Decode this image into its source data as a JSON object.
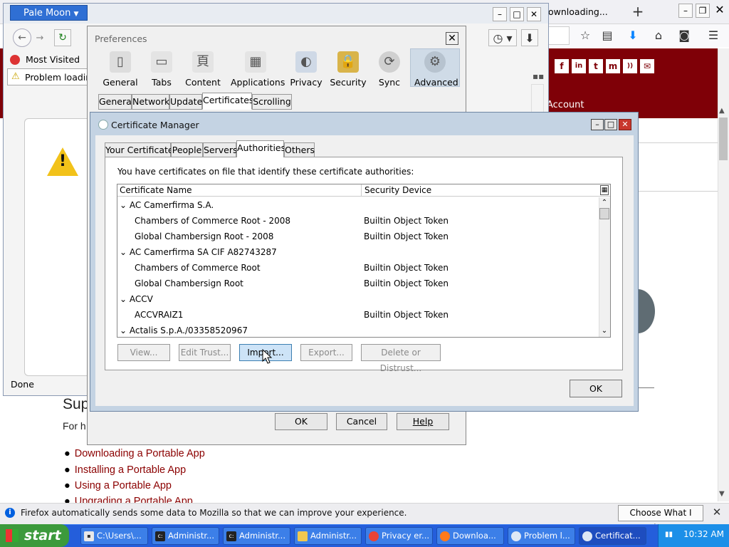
{
  "firefox": {
    "tab_title": "ownloading...",
    "social_icons": [
      "f",
      "in",
      "t",
      "m",
      "rss",
      "mail"
    ],
    "account_label": "Account",
    "heading_fragment": "Sup",
    "paragraph_fragment": "For h",
    "links": [
      "Downloading a Portable App",
      "Installing a Portable App",
      "Using a Portable App",
      "Upgrading a Portable App"
    ],
    "notification_text": "Firefox automatically sends some data to Mozilla so that we can improve your experience.",
    "notification_button": "Choose What I Share",
    "accent_color": "#7f0007"
  },
  "palemoon": {
    "menu_button": "Pale Moon",
    "most_visited": "Most Visited",
    "tab_title": "Problem loading",
    "status": "Done"
  },
  "preferences": {
    "title": "Preferences",
    "tabs": [
      "General",
      "Tabs",
      "Content",
      "Applications",
      "Privacy",
      "Security",
      "Sync",
      "Advanced"
    ],
    "subtabs": [
      "General",
      "Network",
      "Update",
      "Certificates",
      "Scrolling"
    ],
    "selected_subtab": "Certificates",
    "buttons": {
      "ok": "OK",
      "cancel": "Cancel",
      "help": "Help"
    }
  },
  "cert_manager": {
    "title": "Certificate Manager",
    "tabs": [
      "Your Certificates",
      "People",
      "Servers",
      "Authorities",
      "Others"
    ],
    "selected_tab": "Authorities",
    "description": "You have certificates on file that identify these certificate authorities:",
    "columns": {
      "name": "Certificate Name",
      "device": "Security Device"
    },
    "rows": [
      {
        "name": "AC Camerfirma S.A.",
        "device": "",
        "group": true
      },
      {
        "name": "Chambers of Commerce Root - 2008",
        "device": "Builtin Object Token",
        "group": false
      },
      {
        "name": "Global Chambersign Root - 2008",
        "device": "Builtin Object Token",
        "group": false
      },
      {
        "name": "AC Camerfirma SA CIF A82743287",
        "device": "",
        "group": true
      },
      {
        "name": "Chambers of Commerce Root",
        "device": "Builtin Object Token",
        "group": false
      },
      {
        "name": "Global Chambersign Root",
        "device": "Builtin Object Token",
        "group": false
      },
      {
        "name": "ACCV",
        "device": "",
        "group": true
      },
      {
        "name": "ACCVRAIZ1",
        "device": "Builtin Object Token",
        "group": false
      },
      {
        "name": "Actalis S.p.A./03358520967",
        "device": "",
        "group": true
      }
    ],
    "buttons": {
      "view": "View...",
      "edit_trust": "Edit Trust...",
      "import": "Import...",
      "export": "Export...",
      "delete": "Delete or Distrust...",
      "ok": "OK"
    }
  },
  "taskbar": {
    "start": "start",
    "items": [
      {
        "label": "C:\\Users\\...",
        "icon": "cmd-icon"
      },
      {
        "label": "Administr...",
        "icon": "cmd-icon"
      },
      {
        "label": "Administr...",
        "icon": "cmd-icon"
      },
      {
        "label": "Administr...",
        "icon": "folder-icon"
      },
      {
        "label": "Privacy er...",
        "icon": "chrome-icon"
      },
      {
        "label": "Downloa...",
        "icon": "firefox-icon"
      },
      {
        "label": "Problem l...",
        "icon": "palemoon-icon"
      },
      {
        "label": "Certificat...",
        "icon": "palemoon-icon"
      }
    ],
    "clock": "10:32 AM"
  }
}
